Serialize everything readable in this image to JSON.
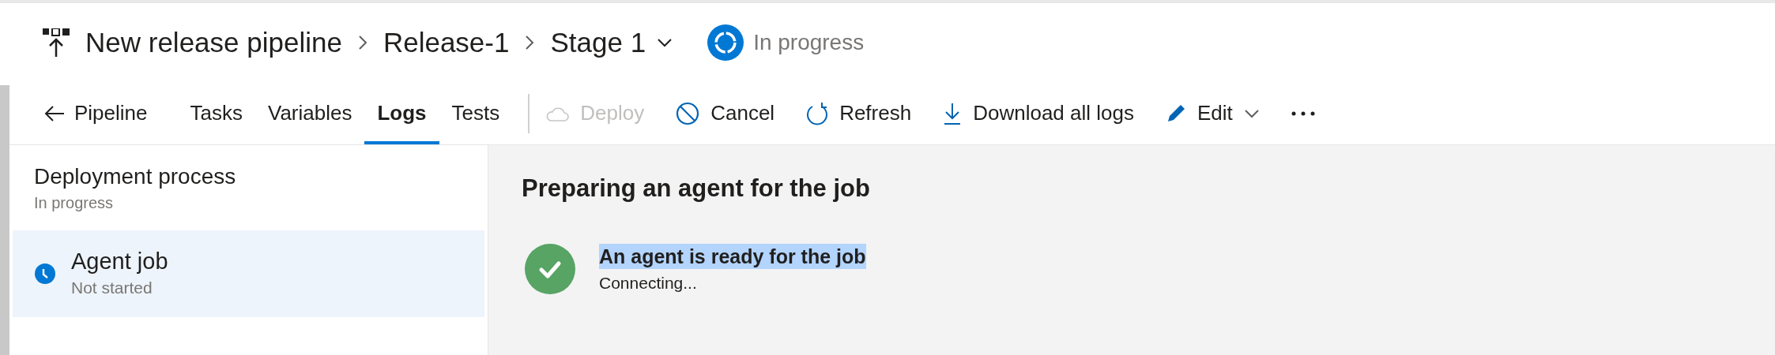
{
  "breadcrumb": [
    {
      "label": "New release pipeline"
    },
    {
      "label": "Release-1"
    },
    {
      "label": "Stage 1",
      "dropdown": true
    }
  ],
  "status": {
    "label": "In progress"
  },
  "back_link": {
    "label": "Pipeline"
  },
  "tabs": [
    {
      "label": "Tasks",
      "selected": false
    },
    {
      "label": "Variables",
      "selected": false
    },
    {
      "label": "Logs",
      "selected": true
    },
    {
      "label": "Tests",
      "selected": false
    }
  ],
  "actions": [
    {
      "kind": "cloud",
      "label": "Deploy",
      "disabled": true
    },
    {
      "kind": "cancel",
      "label": "Cancel",
      "disabled": false
    },
    {
      "kind": "refresh",
      "label": "Refresh",
      "disabled": false
    },
    {
      "kind": "download",
      "label": "Download all logs",
      "disabled": false
    },
    {
      "kind": "edit",
      "label": "Edit",
      "disabled": false,
      "dropdown": true
    },
    {
      "kind": "more",
      "disabled": false
    }
  ],
  "sidebar": {
    "title": "Deployment process",
    "subtitle": "In progress",
    "items": [
      {
        "title": "Agent job",
        "subtitle": "Not started",
        "selected": true
      }
    ]
  },
  "log": {
    "title": "Preparing an agent for the job",
    "steps": [
      {
        "title": "An agent is ready for the job",
        "detail": "Connecting...",
        "highlighted": true
      }
    ]
  }
}
